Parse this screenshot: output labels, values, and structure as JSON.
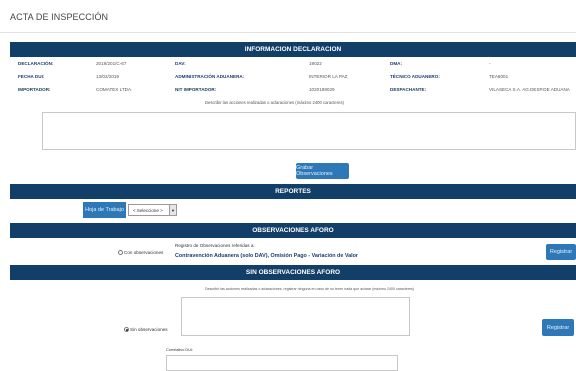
{
  "page_title": "ACTA DE INSPECCIÓN",
  "sections": {
    "info": "INFORMACION DECLARACION",
    "reportes": "REPORTES",
    "obs_aforo": "OBSERVACIONES AFORO",
    "sin_obs": "SIN OBSERVACIONES AFORO"
  },
  "declaracion": {
    "rows": [
      [
        {
          "label": "DECLARACIÓN:",
          "value": "2019/201/C-67"
        },
        {
          "label": "DAV:",
          "value": "19022"
        },
        {
          "label": "DMA:",
          "value": "-"
        }
      ],
      [
        {
          "label": "FECHA DUI:",
          "value": "13/02/2019"
        },
        {
          "label": "ADMINISTRACIÓN ADUANERA:",
          "value": "INTERIOR LA PAZ"
        },
        {
          "label": "TÉCNICO ADUANERO:",
          "value": "TEA6001"
        }
      ],
      [
        {
          "label": "IMPORTADOR:",
          "value": "COMATEX LTDA."
        },
        {
          "label": "NIT IMPORTADOR:",
          "value": "1020189029"
        },
        {
          "label": "DESPACHANTE:",
          "value": "VILASECA S.A. AG.DESP.DE ADUANA"
        }
      ]
    ],
    "describe_hint": "Describir las acciones realizadas o aclaraciones (máximo 2400 caracteres)",
    "save_button": "Grabar Observaciones"
  },
  "reportes": {
    "hoja_button": "Hoja de Trabajo",
    "select_value": "< Seleccione >"
  },
  "obs_aforo": {
    "radio_label": "Con observaciones",
    "registro_label": "Registro de Observaciones referidas a:",
    "registro_value": "Contravención Aduanera (solo DAV), Omisión Pago - Variación de Valor",
    "register_button": "Registrar"
  },
  "sin_obs": {
    "hint": "Describir las acciones realizadas o aclaraciones, registrar ninguna en caso de no tener nada que aclarar (máximo 2400 caracteres)",
    "radio_label": "Sin observaciones",
    "register_button": "Registrar",
    "comment_label": "Correlativo DUI:"
  }
}
